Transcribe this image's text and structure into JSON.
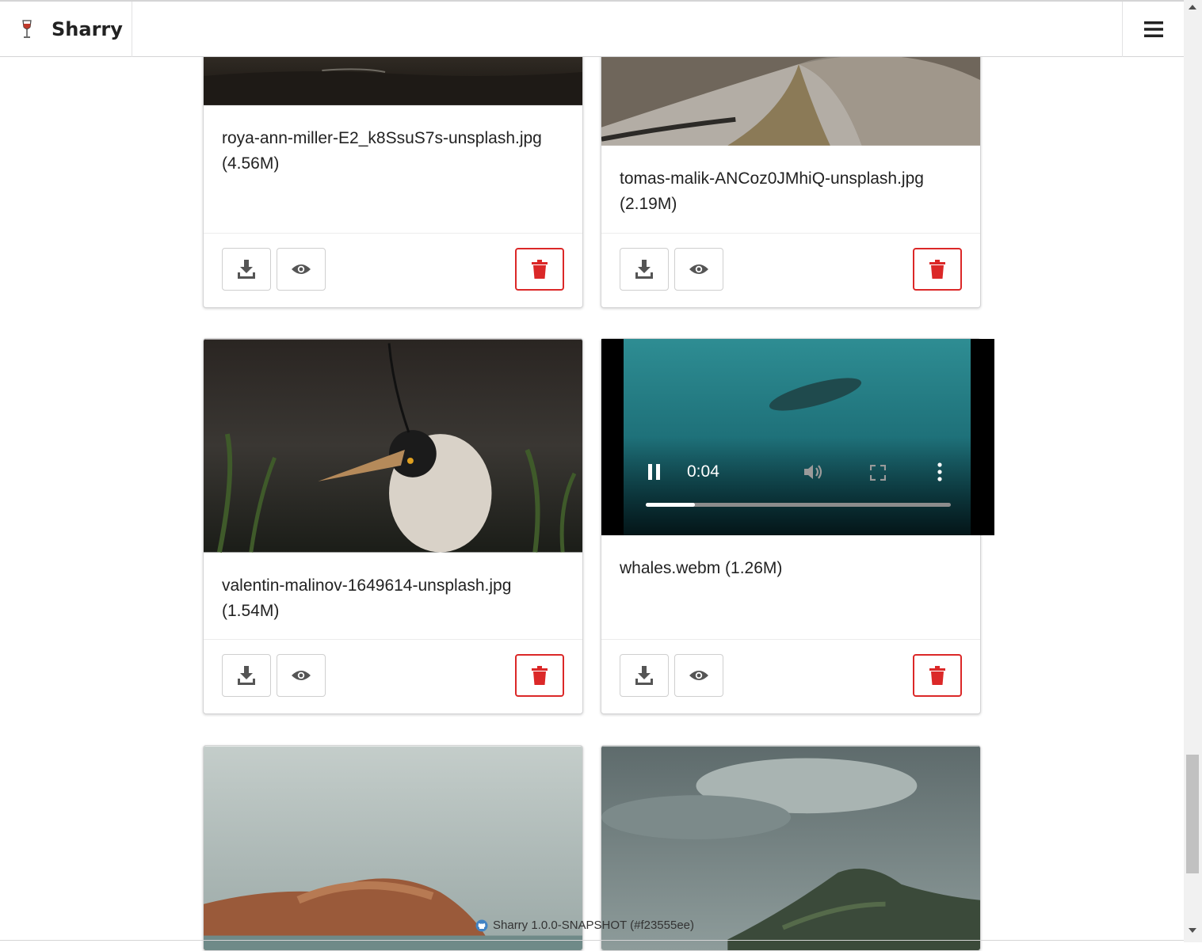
{
  "app": {
    "title": "Sharry"
  },
  "files": [
    {
      "name": "roya-ann-miller-E2_k8SsuS7s-unsplash.jpg (4.56M)"
    },
    {
      "name": "tomas-malik-ANCoz0JMhiQ-unsplash.jpg (2.19M)"
    },
    {
      "name": "valentin-malinov-1649614-unsplash.jpg (1.54M)"
    },
    {
      "name": "whales.webm (1.26M)",
      "video": {
        "time": "0:04",
        "progress": 0.16
      }
    }
  ],
  "footer": {
    "text": "Sharry 1.0.0-SNAPSHOT (#f23555ee)"
  },
  "colors": {
    "danger": "#db2828",
    "border": "#d4d4d5"
  }
}
